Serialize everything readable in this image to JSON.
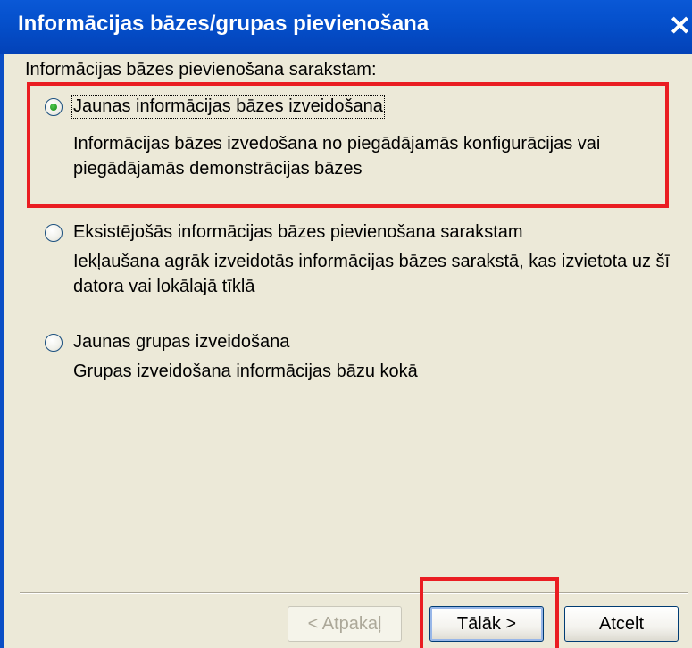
{
  "dialog": {
    "title": "Informācijas bāzes/grupas pievienošana",
    "close_glyph": "✕"
  },
  "group_label": "Informācijas bāzes pievienošana sarakstam:",
  "options": [
    {
      "label": "Jaunas informācijas bāzes izveidošana",
      "description": "Informācijas bāzes izvedošana no piegādājamās konfigurācijas vai piegādājamās demonstrācijas bāzes",
      "selected": true
    },
    {
      "label": "Eksistējošās informācijas bāzes pievienošana sarakstam",
      "description": "Iekļaušana agrāk izveidotās informācijas bāzes sarakstā, kas izvietota uz šī datora vai lokālajā tīklā",
      "selected": false
    },
    {
      "label": "Jaunas grupas izveidošana",
      "description": "Grupas izveidošana informācijas bāzu kokā",
      "selected": false
    }
  ],
  "buttons": {
    "back_label": "< Atpakaļ",
    "next_label": "Tālāk >",
    "cancel_label": "Atcelt"
  },
  "colors": {
    "titlebar": "#0550cc",
    "dialog_bg": "#ece9d8",
    "highlight": "#ea1d22"
  },
  "icons": {
    "close": "close-icon",
    "radio": "radio-button"
  }
}
